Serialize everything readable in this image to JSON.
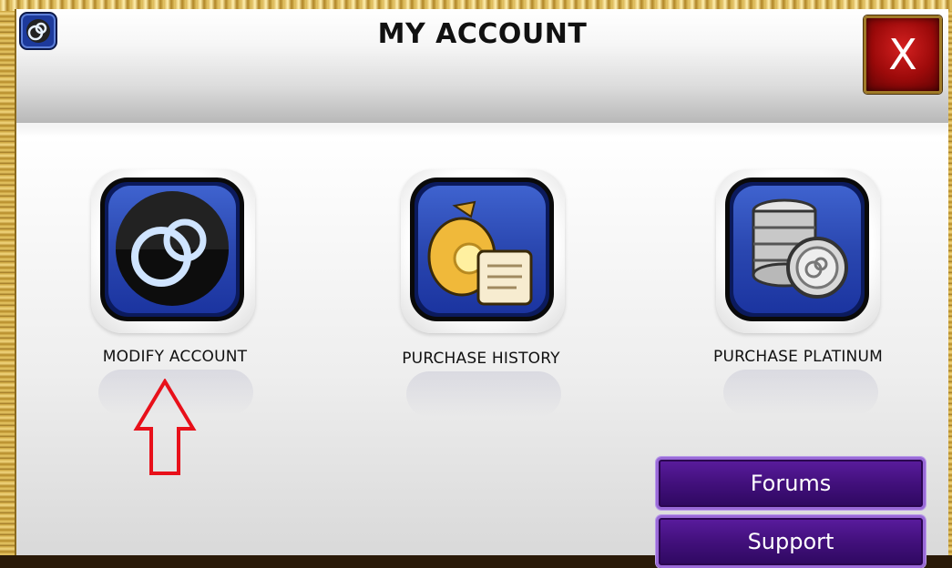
{
  "window": {
    "title": "MY ACCOUNT",
    "close_label": "X"
  },
  "tiles": [
    {
      "label": "MODIFY ACCOUNT",
      "icon": "rings-icon"
    },
    {
      "label": "PURCHASE HISTORY",
      "icon": "money-bag-scroll-icon"
    },
    {
      "label": "PURCHASE PLATINUM",
      "icon": "platinum-coins-icon"
    }
  ],
  "buttons": {
    "forums": "Forums",
    "support": "Support"
  },
  "colors": {
    "tile_blue": "#2a47b0",
    "close_red": "#b01010",
    "button_purple": "#42107c",
    "frame_gold": "#d9b455",
    "annotation_arrow": "#e8101a"
  }
}
